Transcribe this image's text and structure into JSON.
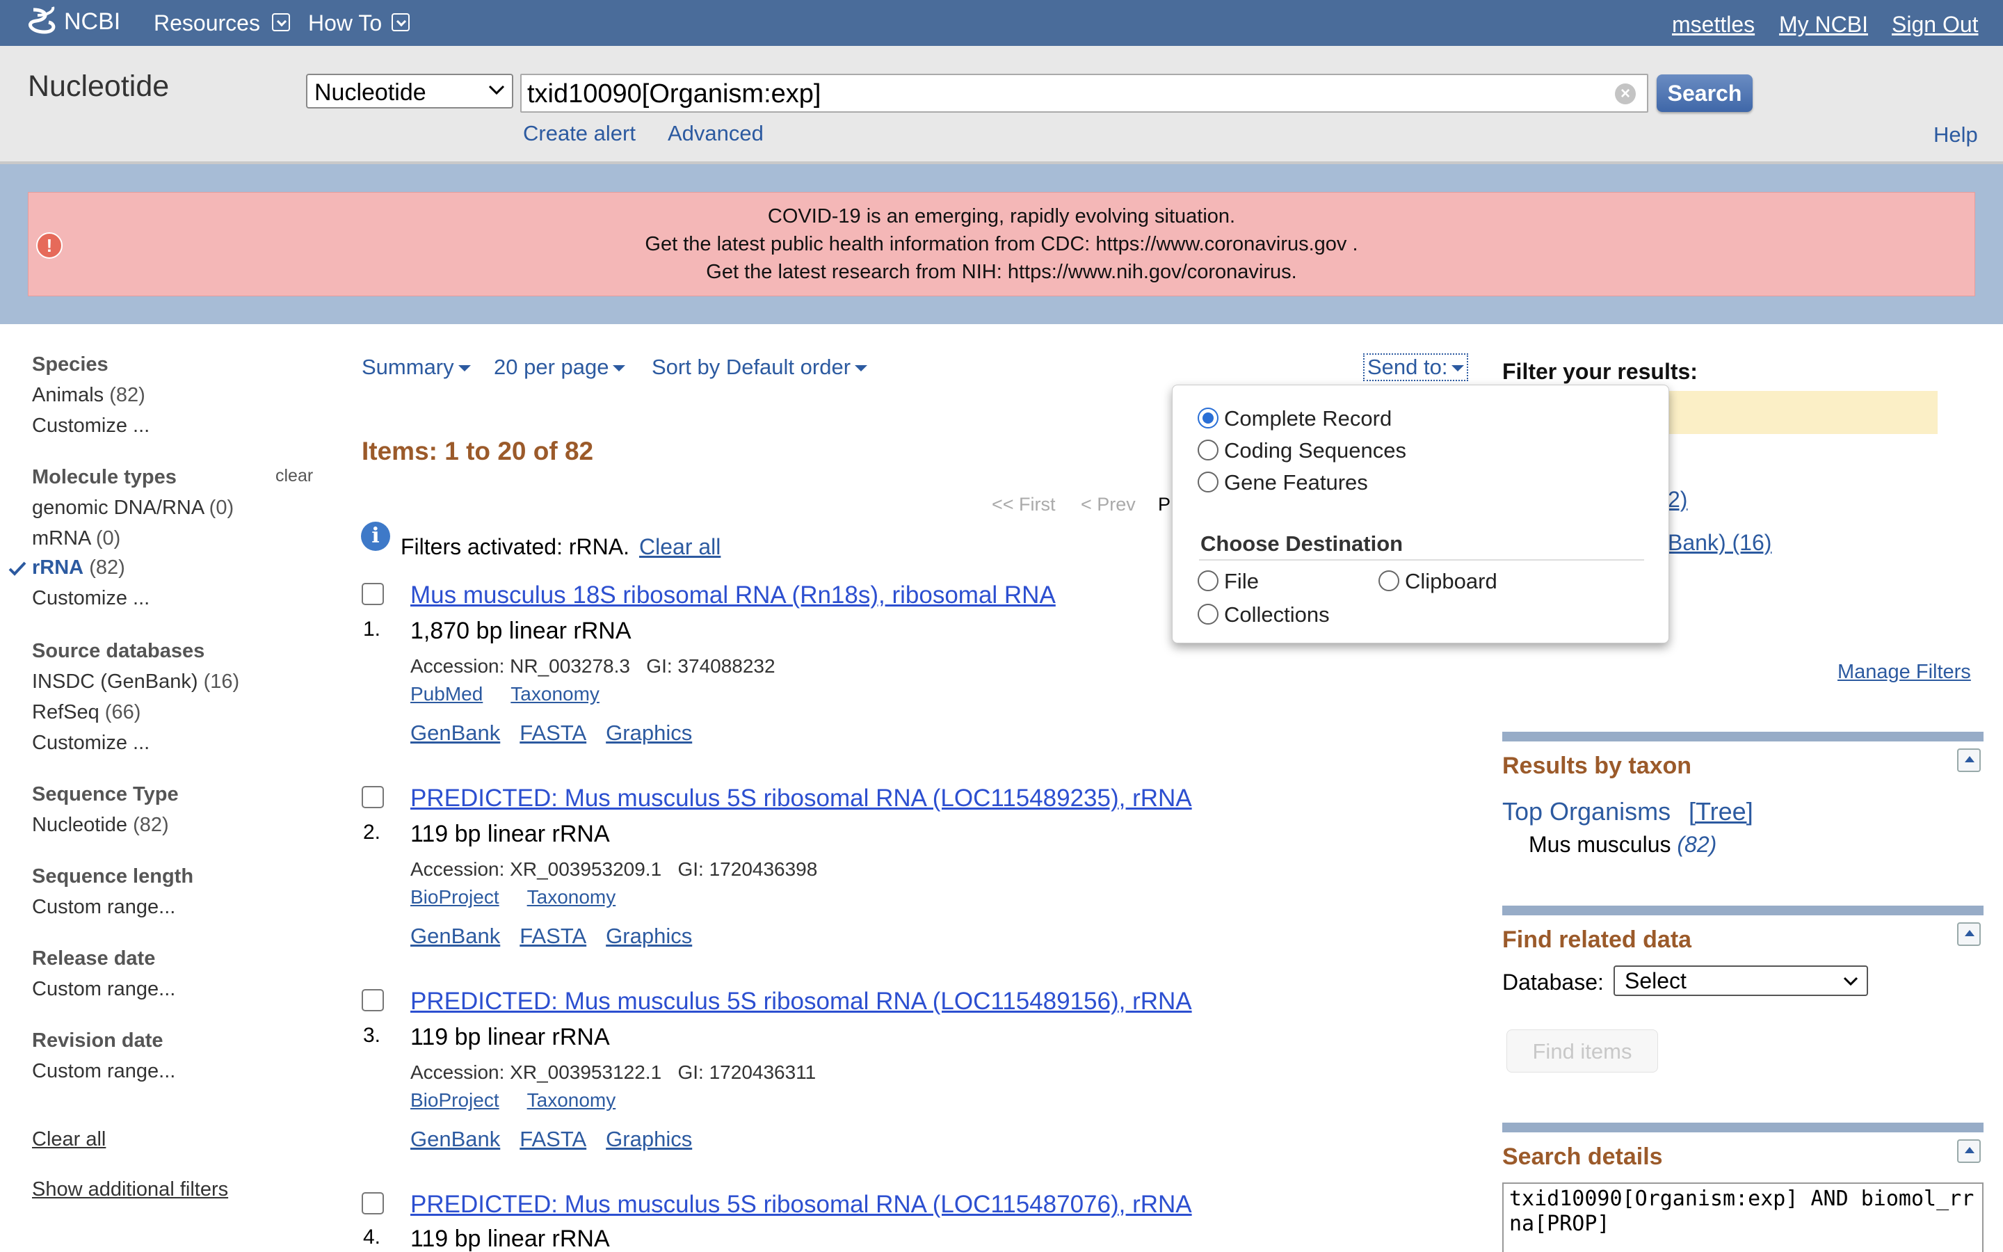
{
  "topbar": {
    "logo": "NCBI",
    "resources": "Resources",
    "how_to": "How To",
    "user": "msettles",
    "my_ncbi": "My NCBI",
    "sign_out": "Sign Out"
  },
  "search": {
    "db_title": "Nucleotide",
    "db_select": "Nucleotide",
    "query": "txid10090[Organism:exp]",
    "button": "Search",
    "create_alert": "Create alert",
    "advanced": "Advanced",
    "help": "Help"
  },
  "banner": {
    "line1": "COVID-19 is an emerging, rapidly evolving situation.",
    "line2_prefix": "Get the latest public health information from CDC: ",
    "line2_link": "https://www.coronavirus.gov",
    "line2_suffix": " .",
    "line3_prefix": "Get the latest research from NIH: ",
    "line3_link": "https://www.nih.gov/coronavirus",
    "line3_suffix": "."
  },
  "sidebar": {
    "species": {
      "heading": "Species",
      "animals": "Animals",
      "animals_count": "(82)",
      "customize": "Customize ..."
    },
    "molecule": {
      "heading": "Molecule types",
      "clear": "clear",
      "genomic": "genomic DNA/RNA",
      "genomic_count": "(0)",
      "mrna": "mRNA",
      "mrna_count": "(0)",
      "rrna": "rRNA",
      "rrna_count": "(82)",
      "customize": "Customize ..."
    },
    "source": {
      "heading": "Source databases",
      "insdc": "INSDC (GenBank)",
      "insdc_count": "(16)",
      "refseq": "RefSeq",
      "refseq_count": "(66)",
      "customize": "Customize ..."
    },
    "seqtype": {
      "heading": "Sequence Type",
      "nucleotide": "Nucleotide",
      "nucleotide_count": "(82)"
    },
    "seqlen": {
      "heading": "Sequence length",
      "custom": "Custom range..."
    },
    "release": {
      "heading": "Release date",
      "custom": "Custom range..."
    },
    "revision": {
      "heading": "Revision date",
      "custom": "Custom range..."
    },
    "clear_all": "Clear all",
    "show_additional": "Show additional filters"
  },
  "toolbar": {
    "summary": "Summary",
    "per_page": "20 per page",
    "sort": "Sort by Default order",
    "send_to": "Send to:"
  },
  "results_header": {
    "items": "Items: 1 to 20 of 82",
    "first": "<< First",
    "prev": "< Prev",
    "page_partial": "P",
    "filters_prefix": "Filters activated: rRNA.",
    "clear_all": "Clear all"
  },
  "results": [
    {
      "num": "1.",
      "title": "Mus musculus 18S ribosomal RNA (Rn18s), ribosomal RNA",
      "desc": "1,870 bp linear rRNA",
      "accession": "Accession: NR_003278.3   GI: 374088232",
      "link1": "PubMed",
      "link2": "Taxonomy",
      "tools": [
        "GenBank",
        "FASTA",
        "Graphics"
      ]
    },
    {
      "num": "2.",
      "title": "PREDICTED: Mus musculus 5S ribosomal RNA (LOC115489235), rRNA",
      "desc": "119 bp linear rRNA",
      "accession": "Accession: XR_003953209.1   GI: 1720436398",
      "link1": "BioProject",
      "link2": "Taxonomy",
      "tools": [
        "GenBank",
        "FASTA",
        "Graphics"
      ]
    },
    {
      "num": "3.",
      "title": "PREDICTED: Mus musculus 5S ribosomal RNA (LOC115489156), rRNA",
      "desc": "119 bp linear rRNA",
      "accession": "Accession: XR_003953122.1   GI: 1720436311",
      "link1": "BioProject",
      "link2": "Taxonomy",
      "tools": [
        "GenBank",
        "FASTA",
        "Graphics"
      ]
    },
    {
      "num": "4.",
      "title": "PREDICTED: Mus musculus 5S ribosomal RNA (LOC115487076), rRNA",
      "desc": "119 bp linear rRNA"
    }
  ],
  "send_popup": {
    "options": [
      "Complete Record",
      "Coding Sequences",
      "Gene Features"
    ],
    "selected": "Complete Record",
    "dest_heading": "Choose Destination",
    "dest_file": "File",
    "dest_clipboard": "Clipboard",
    "dest_collections": "Collections"
  },
  "right": {
    "filter_heading": "Filter your results:",
    "partial_link1": "2)",
    "partial_link2": "Bank) (16)",
    "manage_filters": "Manage Filters",
    "taxon_heading": "Results by taxon",
    "top_organisms": "Top Organisms",
    "tree": "[Tree]",
    "organism": "Mus musculus",
    "organism_count": "(82)",
    "related_heading": "Find related data",
    "database_label": "Database:",
    "database_select": "Select",
    "find_items": "Find items",
    "details_heading": "Search details",
    "details_text": "txid10090[Organism:exp] AND biomol_rrna[PROP]"
  }
}
